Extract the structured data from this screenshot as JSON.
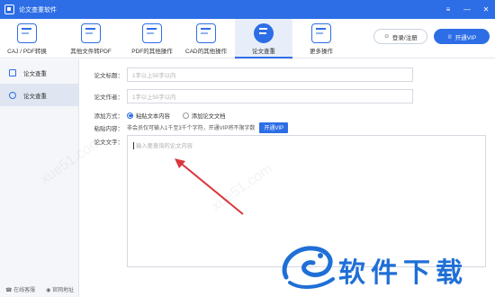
{
  "window": {
    "title": "论文查重软件",
    "controls": [
      "≡",
      "—",
      "✕"
    ]
  },
  "toolbar": {
    "items": [
      {
        "label": "CAJ / PDF转换",
        "icon": "convert-icon"
      },
      {
        "label": "其他文件转PDF",
        "icon": "folder-pdf-icon"
      },
      {
        "label": "PDF的其他操作",
        "icon": "pdf-ops-icon"
      },
      {
        "label": "CAD的其他操作",
        "icon": "cad-ops-icon"
      },
      {
        "label": "论文查重",
        "icon": "plagiarism-check-icon"
      },
      {
        "label": "更多操作",
        "icon": "more-ops-icon"
      }
    ],
    "login_label": "登录/注册",
    "vip_label": "开通VIP"
  },
  "sidebar": {
    "items": [
      {
        "label": "论文查重"
      },
      {
        "label": "论文查重"
      }
    ],
    "bottom": {
      "service": "在线客服",
      "website": "官网地址"
    }
  },
  "form": {
    "title_label": "论文标题：",
    "title_placeholder": "1字以上50字以内",
    "author_label": "论文作者：",
    "author_placeholder": "1字以上50字以内",
    "method_label": "添加方式：",
    "method_options": [
      "粘贴文本内容",
      "添加论文文档"
    ],
    "paste_label": "粘贴内容：",
    "paste_hint": "非会员仅可输入1千至3千个字符，开通VIP将不限字数",
    "paste_vip": "开通VIP",
    "text_label": "论文文字：",
    "text_placeholder": "输入要查询的论文内容"
  },
  "watermark": {
    "brand_text": "软件下载"
  },
  "colors": {
    "accent": "#2d6ee6",
    "annotation_arrow": "#d9363e"
  }
}
